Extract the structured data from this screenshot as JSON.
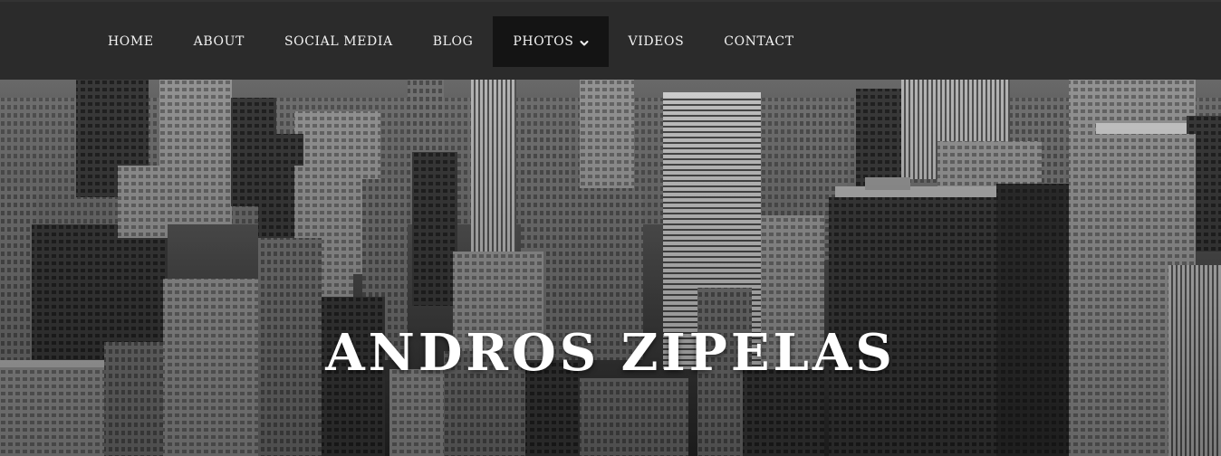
{
  "nav": {
    "items": [
      {
        "label": "HOME"
      },
      {
        "label": "ABOUT"
      },
      {
        "label": "SOCIAL MEDIA"
      },
      {
        "label": "BLOG"
      },
      {
        "label": "PHOTOS",
        "has_dropdown": true,
        "active": true
      },
      {
        "label": "VIDEOS"
      },
      {
        "label": "CONTACT"
      }
    ]
  },
  "hero": {
    "title": "ANDROS ZIPELAS",
    "background": "black-and-white city skyline photo"
  },
  "colors": {
    "nav_background": "#2b2b2b",
    "nav_active_background": "#141414",
    "nav_text": "#f2f2f2",
    "hero_title": "#ffffff"
  },
  "icons": {
    "photos_dropdown": "chevron-down-icon"
  }
}
